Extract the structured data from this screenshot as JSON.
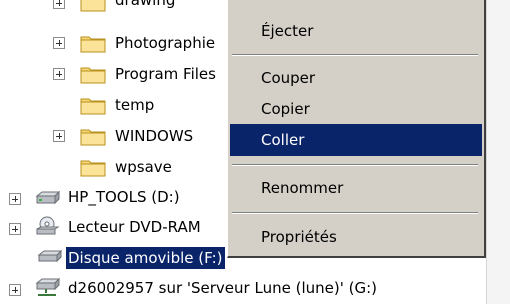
{
  "tree": {
    "items": [
      {
        "label": "drawing",
        "icon": "folder-icon",
        "expander": true
      },
      {
        "label": "Photographie",
        "icon": "folder-icon",
        "expander": true
      },
      {
        "label": "Program Files",
        "icon": "folder-icon",
        "expander": true
      },
      {
        "label": "temp",
        "icon": "folder-icon",
        "expander": false
      },
      {
        "label": "WINDOWS",
        "icon": "folder-icon",
        "expander": true
      },
      {
        "label": "wpsave",
        "icon": "folder-icon",
        "expander": false
      },
      {
        "label": "HP_TOOLS (D:)",
        "icon": "hard-drive-icon",
        "expander": true
      },
      {
        "label": "Lecteur DVD-RAM",
        "icon": "dvd-drive-icon",
        "expander": true
      },
      {
        "label": "Disque amovible (F:)",
        "icon": "removable-drive-icon",
        "expander": false,
        "selected": true
      },
      {
        "label": "d26002957 sur 'Serveur Lune (lune)' (G:)",
        "icon": "network-drive-icon",
        "expander": true
      }
    ]
  },
  "context_menu": {
    "items": [
      {
        "label": "Éjecter"
      },
      {
        "label": "Couper"
      },
      {
        "label": "Copier"
      },
      {
        "label": "Coller",
        "highlighted": true
      },
      {
        "label": "Renommer"
      },
      {
        "label": "Propriétés"
      }
    ]
  },
  "colors": {
    "selection": "#0a246a",
    "menu_background": "#d4d0c8",
    "folder": "#f6d776"
  }
}
